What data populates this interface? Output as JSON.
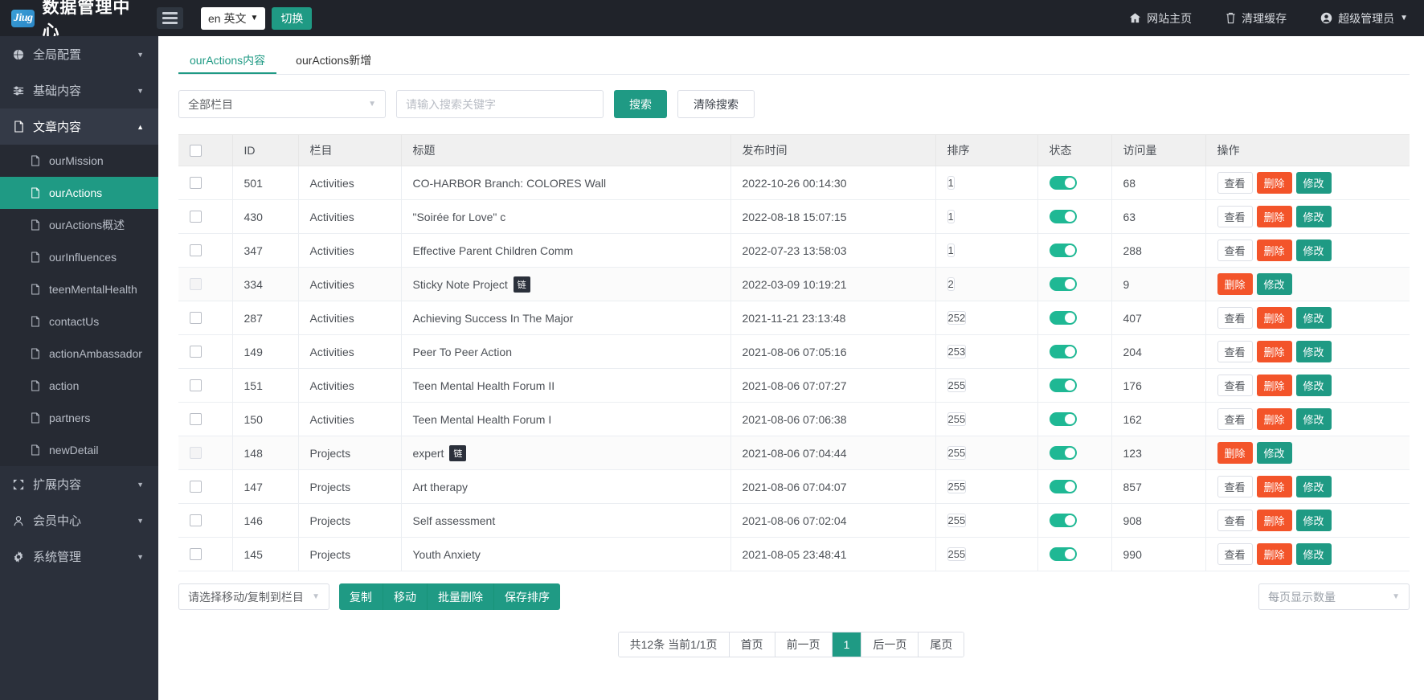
{
  "header": {
    "logo_text": "Jiug",
    "title": "数据管理中心",
    "menu_icon": "hamburger-icon",
    "language_value": "en 英文",
    "switch_label": "切换",
    "right_items": [
      {
        "label": "网站主页",
        "icon": "home-icon"
      },
      {
        "label": "清理缓存",
        "icon": "trash-icon"
      },
      {
        "label": "超级管理员",
        "icon": "user-circle-icon"
      }
    ]
  },
  "sidebar": {
    "groups": [
      {
        "label": "全局配置",
        "icon": "globe-icon",
        "open": false
      },
      {
        "label": "基础内容",
        "icon": "sliders-icon",
        "open": false
      },
      {
        "label": "文章内容",
        "icon": "document-icon",
        "open": true
      },
      {
        "label": "扩展内容",
        "icon": "expand-icon",
        "open": false
      },
      {
        "label": "会员中心",
        "icon": "user-icon",
        "open": false
      },
      {
        "label": "系统管理",
        "icon": "gear-icon",
        "open": false
      }
    ],
    "article_items": [
      {
        "label": "ourMission",
        "active": false
      },
      {
        "label": "ourActions",
        "active": true
      },
      {
        "label": "ourActions概述",
        "active": false
      },
      {
        "label": "ourInfluences",
        "active": false
      },
      {
        "label": "teenMentalHealth",
        "active": false
      },
      {
        "label": "contactUs",
        "active": false
      },
      {
        "label": "actionAmbassador",
        "active": false
      },
      {
        "label": "action",
        "active": false
      },
      {
        "label": "partners",
        "active": false
      },
      {
        "label": "newDetail",
        "active": false
      }
    ]
  },
  "tabs": [
    {
      "label": "ourActions内容",
      "active": true
    },
    {
      "label": "ourActions新增",
      "active": false
    }
  ],
  "search": {
    "category_value": "全部栏目",
    "keyword_value": "",
    "keyword_placeholder": "请输入搜索关键字",
    "search_label": "搜索",
    "clear_label": "清除搜索"
  },
  "table": {
    "columns": [
      "",
      "ID",
      "栏目",
      "标题",
      "发布时间",
      "排序",
      "状态",
      "访问量",
      "操作"
    ],
    "action_labels": {
      "view": "查看",
      "delete": "删除",
      "edit": "修改"
    },
    "link_tag": "链",
    "rows": [
      {
        "id": "501",
        "category": "Activities",
        "title": "CO-HARBOR Branch: COLORES Wall",
        "tag": false,
        "time": "2022-10-26 00:14:30",
        "sort": "1",
        "status": true,
        "views": "68",
        "has_view": true,
        "shade": false
      },
      {
        "id": "430",
        "category": "Activities",
        "title": "\"Soirée for Love\" c",
        "tag": false,
        "time": "2022-08-18 15:07:15",
        "sort": "1",
        "status": true,
        "views": "63",
        "has_view": true,
        "shade": false
      },
      {
        "id": "347",
        "category": "Activities",
        "title": "Effective Parent Children Comm",
        "tag": false,
        "time": "2022-07-23 13:58:03",
        "sort": "1",
        "status": true,
        "views": "288",
        "has_view": true,
        "shade": false
      },
      {
        "id": "334",
        "category": "Activities",
        "title": "Sticky Note Project",
        "tag": true,
        "time": "2022-03-09 10:19:21",
        "sort": "2",
        "status": true,
        "views": "9",
        "has_view": false,
        "shade": true
      },
      {
        "id": "287",
        "category": "Activities",
        "title": "Achieving Success In The Major",
        "tag": false,
        "time": "2021-11-21 23:13:48",
        "sort": "252",
        "status": true,
        "views": "407",
        "has_view": true,
        "shade": false
      },
      {
        "id": "149",
        "category": "Activities",
        "title": "Peer To Peer Action",
        "tag": false,
        "time": "2021-08-06 07:05:16",
        "sort": "253",
        "status": true,
        "views": "204",
        "has_view": true,
        "shade": false
      },
      {
        "id": "151",
        "category": "Activities",
        "title": "Teen Mental Health Forum II",
        "tag": false,
        "time": "2021-08-06 07:07:27",
        "sort": "255",
        "status": true,
        "views": "176",
        "has_view": true,
        "shade": false
      },
      {
        "id": "150",
        "category": "Activities",
        "title": "Teen Mental Health Forum I",
        "tag": false,
        "time": "2021-08-06 07:06:38",
        "sort": "255",
        "status": true,
        "views": "162",
        "has_view": true,
        "shade": false
      },
      {
        "id": "148",
        "category": "Projects",
        "title": "expert",
        "tag": true,
        "time": "2021-08-06 07:04:44",
        "sort": "255",
        "status": true,
        "views": "123",
        "has_view": false,
        "shade": true
      },
      {
        "id": "147",
        "category": "Projects",
        "title": "Art therapy",
        "tag": false,
        "time": "2021-08-06 07:04:07",
        "sort": "255",
        "status": true,
        "views": "857",
        "has_view": true,
        "shade": false
      },
      {
        "id": "146",
        "category": "Projects",
        "title": "Self assessment",
        "tag": false,
        "time": "2021-08-06 07:02:04",
        "sort": "255",
        "status": true,
        "views": "908",
        "has_view": true,
        "shade": false
      },
      {
        "id": "145",
        "category": "Projects",
        "title": "Youth Anxiety",
        "tag": false,
        "time": "2021-08-05 23:48:41",
        "sort": "255",
        "status": true,
        "views": "990",
        "has_view": true,
        "shade": false
      }
    ]
  },
  "bottom": {
    "move_copy_value": "请选择移动/复制到栏目",
    "buttons": [
      "复制",
      "移动",
      "批量删除",
      "保存排序"
    ],
    "per_page_value": "每页显示数量"
  },
  "pagination": {
    "info": "共12条 当前1/1页",
    "first": "首页",
    "prev": "前一页",
    "current": "1",
    "next": "后一页",
    "last": "尾页"
  },
  "colors": {
    "accent": "#1f9a84",
    "danger": "#f3542a",
    "toggle_on": "#1fb894",
    "sidebar_bg": "#2b303b",
    "topbar_bg": "#20232a"
  }
}
